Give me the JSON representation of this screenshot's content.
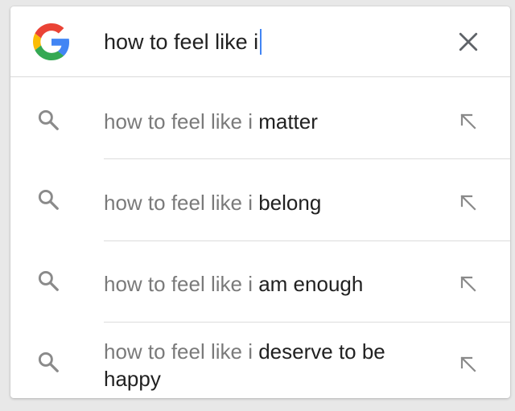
{
  "search": {
    "query": "how to feel like i",
    "clear_icon": "close-icon",
    "logo_icon": "google-g-logo",
    "colors": {
      "caret": "#4285f4",
      "blue": "#4285f4",
      "red": "#ea4335",
      "yellow": "#fbbc05",
      "green": "#34a853"
    }
  },
  "suggestions": [
    {
      "prefix": "how to feel like i",
      "completion": "matter",
      "icon": "search-icon",
      "action_icon": "fill-query-arrow-icon"
    },
    {
      "prefix": "how to feel like i",
      "completion": "belong",
      "icon": "search-icon",
      "action_icon": "fill-query-arrow-icon"
    },
    {
      "prefix": "how to feel like i",
      "completion": "am enough",
      "icon": "search-icon",
      "action_icon": "fill-query-arrow-icon"
    },
    {
      "prefix": "how to feel like i",
      "completion": "deserve to be happy",
      "icon": "search-icon",
      "action_icon": "fill-query-arrow-icon"
    }
  ]
}
